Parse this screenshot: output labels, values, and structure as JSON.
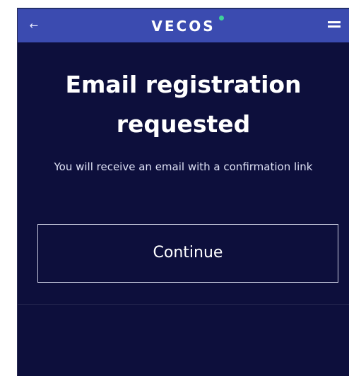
{
  "header": {
    "back_glyph": "←",
    "brand": "VECOS",
    "status_color": "#3ed19a",
    "menu_icon": "hamburger-menu-icon"
  },
  "main": {
    "title": "Email registration requested",
    "message": "You will receive an email with a confirmation link",
    "continue_label": "Continue"
  },
  "colors": {
    "background": "#0d0f3c",
    "header_bg": "#3b4bb0",
    "text": "#ffffff"
  }
}
